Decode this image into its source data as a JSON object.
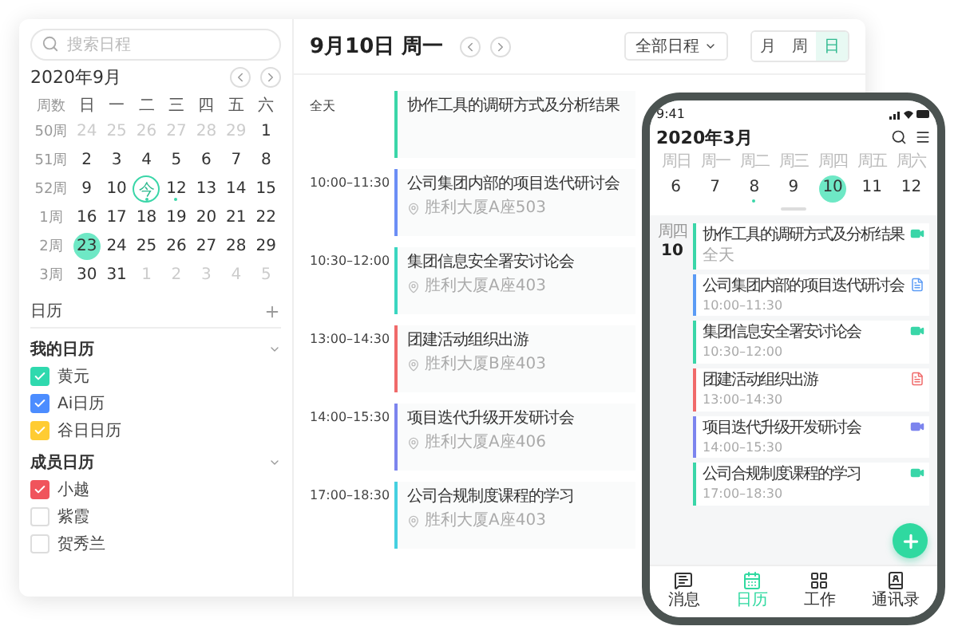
{
  "desktop": {
    "search": {
      "placeholder": "搜索日程"
    },
    "mini_calendar": {
      "month": "2020年9月",
      "week_header": "周数",
      "weekdays": [
        "日",
        "一",
        "二",
        "三",
        "四",
        "五",
        "六"
      ],
      "weeks": [
        {
          "week": "50周",
          "days": [
            {
              "d": "24",
              "muted": true,
              "today": false,
              "selected": false,
              "dot": false
            },
            {
              "d": "25",
              "muted": true,
              "today": false,
              "selected": false,
              "dot": false
            },
            {
              "d": "26",
              "muted": true,
              "today": false,
              "selected": false,
              "dot": false
            },
            {
              "d": "27",
              "muted": true,
              "today": false,
              "selected": false,
              "dot": false
            },
            {
              "d": "28",
              "muted": true,
              "today": false,
              "selected": false,
              "dot": false
            },
            {
              "d": "29",
              "muted": true,
              "today": false,
              "selected": false,
              "dot": false
            },
            {
              "d": "1",
              "muted": false,
              "today": false,
              "selected": false,
              "dot": false
            }
          ]
        },
        {
          "week": "51周",
          "days": [
            {
              "d": "2",
              "muted": false,
              "today": false,
              "selected": false,
              "dot": false
            },
            {
              "d": "3",
              "muted": false,
              "today": false,
              "selected": false,
              "dot": false
            },
            {
              "d": "4",
              "muted": false,
              "today": false,
              "selected": false,
              "dot": false
            },
            {
              "d": "5",
              "muted": false,
              "today": false,
              "selected": false,
              "dot": false
            },
            {
              "d": "6",
              "muted": false,
              "today": false,
              "selected": false,
              "dot": false
            },
            {
              "d": "7",
              "muted": false,
              "today": false,
              "selected": false,
              "dot": false
            },
            {
              "d": "8",
              "muted": false,
              "today": false,
              "selected": false,
              "dot": false
            }
          ]
        },
        {
          "week": "52周",
          "days": [
            {
              "d": "9",
              "muted": false,
              "today": false,
              "selected": false,
              "dot": false
            },
            {
              "d": "10",
              "muted": false,
              "today": false,
              "selected": false,
              "dot": false
            },
            {
              "d": "今",
              "muted": false,
              "today": true,
              "selected": false,
              "dot": true
            },
            {
              "d": "12",
              "muted": false,
              "today": false,
              "selected": false,
              "dot": true
            },
            {
              "d": "13",
              "muted": false,
              "today": false,
              "selected": false,
              "dot": false
            },
            {
              "d": "14",
              "muted": false,
              "today": false,
              "selected": false,
              "dot": false
            },
            {
              "d": "15",
              "muted": false,
              "today": false,
              "selected": false,
              "dot": false
            }
          ]
        },
        {
          "week": "1周",
          "days": [
            {
              "d": "16",
              "muted": false,
              "today": false,
              "selected": false,
              "dot": false
            },
            {
              "d": "17",
              "muted": false,
              "today": false,
              "selected": false,
              "dot": false
            },
            {
              "d": "18",
              "muted": false,
              "today": false,
              "selected": false,
              "dot": false
            },
            {
              "d": "19",
              "muted": false,
              "today": false,
              "selected": false,
              "dot": false
            },
            {
              "d": "20",
              "muted": false,
              "today": false,
              "selected": false,
              "dot": false
            },
            {
              "d": "21",
              "muted": false,
              "today": false,
              "selected": false,
              "dot": false
            },
            {
              "d": "22",
              "muted": false,
              "today": false,
              "selected": false,
              "dot": false
            }
          ]
        },
        {
          "week": "2周",
          "days": [
            {
              "d": "23",
              "muted": false,
              "today": false,
              "selected": true,
              "dot": false
            },
            {
              "d": "24",
              "muted": false,
              "today": false,
              "selected": false,
              "dot": false
            },
            {
              "d": "25",
              "muted": false,
              "today": false,
              "selected": false,
              "dot": false
            },
            {
              "d": "26",
              "muted": false,
              "today": false,
              "selected": false,
              "dot": false
            },
            {
              "d": "27",
              "muted": false,
              "today": false,
              "selected": false,
              "dot": false
            },
            {
              "d": "28",
              "muted": false,
              "today": false,
              "selected": false,
              "dot": false
            },
            {
              "d": "29",
              "muted": false,
              "today": false,
              "selected": false,
              "dot": false
            }
          ]
        },
        {
          "week": "3周",
          "days": [
            {
              "d": "30",
              "muted": false,
              "today": false,
              "selected": false,
              "dot": false
            },
            {
              "d": "31",
              "muted": false,
              "today": false,
              "selected": false,
              "dot": false
            },
            {
              "d": "1",
              "muted": true,
              "today": false,
              "selected": false,
              "dot": false
            },
            {
              "d": "2",
              "muted": true,
              "today": false,
              "selected": false,
              "dot": false
            },
            {
              "d": "3",
              "muted": true,
              "today": false,
              "selected": false,
              "dot": false
            },
            {
              "d": "4",
              "muted": true,
              "today": false,
              "selected": false,
              "dot": false
            },
            {
              "d": "5",
              "muted": true,
              "today": false,
              "selected": false,
              "dot": false
            }
          ]
        }
      ]
    },
    "calendars": {
      "title": "日历",
      "sections": [
        {
          "title": "我的日历",
          "expanded": true,
          "items": [
            {
              "name": "黄元",
              "checked": true,
              "color": "#2fd9ae"
            },
            {
              "name": "Ai日历",
              "checked": true,
              "color": "#4c8dff"
            },
            {
              "name": "谷日日历",
              "checked": true,
              "color": "#ffcc33"
            }
          ]
        },
        {
          "title": "成员日历",
          "expanded": true,
          "items": [
            {
              "name": "小越",
              "checked": true,
              "color": "#f0545c"
            },
            {
              "name": "紫霞",
              "checked": false
            },
            {
              "name": "贺秀兰",
              "checked": false
            }
          ]
        }
      ]
    },
    "header": {
      "date": "9月10日 周一",
      "filter": "全部日程",
      "views": [
        {
          "label": "月",
          "selected": false
        },
        {
          "label": "周",
          "selected": false
        },
        {
          "label": "日",
          "selected": true
        }
      ]
    },
    "events": [
      {
        "time": "全天",
        "title": "协作工具的调研方式及分析结果",
        "color": "#3ad6a8"
      },
      {
        "time": "10:00–11:30",
        "title": "公司集团内部的项目迭代研讨会",
        "location": "胜利大厦A座503",
        "color": "#6c8ef5"
      },
      {
        "time": "10:30–12:00",
        "title": "集团信息安全署安讨论会",
        "location": "胜利大厦A座403",
        "color": "#3ad6c0"
      },
      {
        "time": "13:00–14:30",
        "title": "团建活动组织出游",
        "location": "胜利大厦B座403",
        "color": "#f06a6a"
      },
      {
        "time": "14:00–15:30",
        "title": "项目迭代升级开发研讨会",
        "location": "胜利大厦A座406",
        "color": "#7c84ee"
      },
      {
        "time": "17:00–18:30",
        "title": "公司合规制度课程的学习",
        "location": "胜利大厦A座403",
        "color": "#45d0e0"
      }
    ]
  },
  "phone": {
    "status_time": "9:41",
    "title": "2020年3月",
    "days": [
      {
        "weekday": "周日",
        "day": "6",
        "selected": false,
        "dot": false
      },
      {
        "weekday": "周一",
        "day": "7",
        "selected": false,
        "dot": false
      },
      {
        "weekday": "周二",
        "day": "8",
        "selected": false,
        "dot": true
      },
      {
        "weekday": "周三",
        "day": "9",
        "selected": false,
        "dot": false
      },
      {
        "weekday": "周四",
        "day": "10",
        "selected": true,
        "dot": false
      },
      {
        "weekday": "周五",
        "day": "11",
        "selected": false,
        "dot": false
      },
      {
        "weekday": "周六",
        "day": "12",
        "selected": false,
        "dot": false
      }
    ],
    "agenda_date": {
      "weekday": "周四",
      "day": "10"
    },
    "events": [
      {
        "title": "协作工具的调研方式及分析结果",
        "time": "全天",
        "color": "#3ad6a8",
        "kind": "video"
      },
      {
        "title": "公司集团内部的项目迭代研讨会",
        "time": "10:00–11:30",
        "color": "#5b9bf5",
        "kind": "doc"
      },
      {
        "title": "集团信息安全署安讨论会",
        "time": "10:30–12:00",
        "color": "#3ad6a8",
        "kind": "video"
      },
      {
        "title": "团建活动组织出游",
        "time": "13:00–14:30",
        "color": "#f06a6a",
        "kind": "doc"
      },
      {
        "title": "项目迭代升级开发研讨会",
        "time": "14:00–15:30",
        "color": "#7c84ee",
        "kind": "video"
      },
      {
        "title": "公司合规制度课程的学习",
        "time": "17:00–18:30",
        "color": "#3ad6a8",
        "kind": "video"
      }
    ],
    "tabs": [
      {
        "label": "消息",
        "kind": "message",
        "selected": false
      },
      {
        "label": "日历",
        "kind": "calendar",
        "selected": true
      },
      {
        "label": "工作",
        "kind": "grid",
        "selected": false
      },
      {
        "label": "通讯录",
        "kind": "contacts",
        "selected": false
      }
    ]
  }
}
